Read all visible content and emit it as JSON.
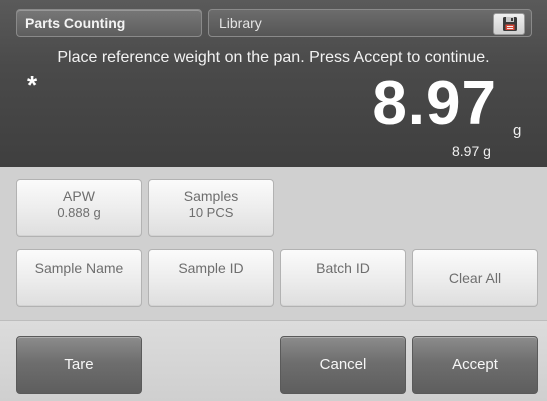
{
  "header": {
    "mode_label": "Parts Counting",
    "library_label": "Library",
    "save_icon": "floppy-disk-icon"
  },
  "display": {
    "instruction": "Place reference weight on the pan.  Press Accept to continue.",
    "stability_indicator": "*",
    "weight": "8.97",
    "unit": "g",
    "secondary_weight": "8.97 g"
  },
  "fields": {
    "apw": {
      "label": "APW",
      "value": "0.888 g"
    },
    "samples": {
      "label": "Samples",
      "value": "10 PCS"
    },
    "sample_name": "Sample Name",
    "sample_id": "Sample ID",
    "batch_id": "Batch ID",
    "clear_all": "Clear All"
  },
  "actions": {
    "tare": "Tare",
    "cancel": "Cancel",
    "accept": "Accept"
  },
  "colors": {
    "display_bg": "#4a4a4a",
    "panel_bg": "#d0d0d0",
    "dark_button": "#6e6e6e"
  }
}
